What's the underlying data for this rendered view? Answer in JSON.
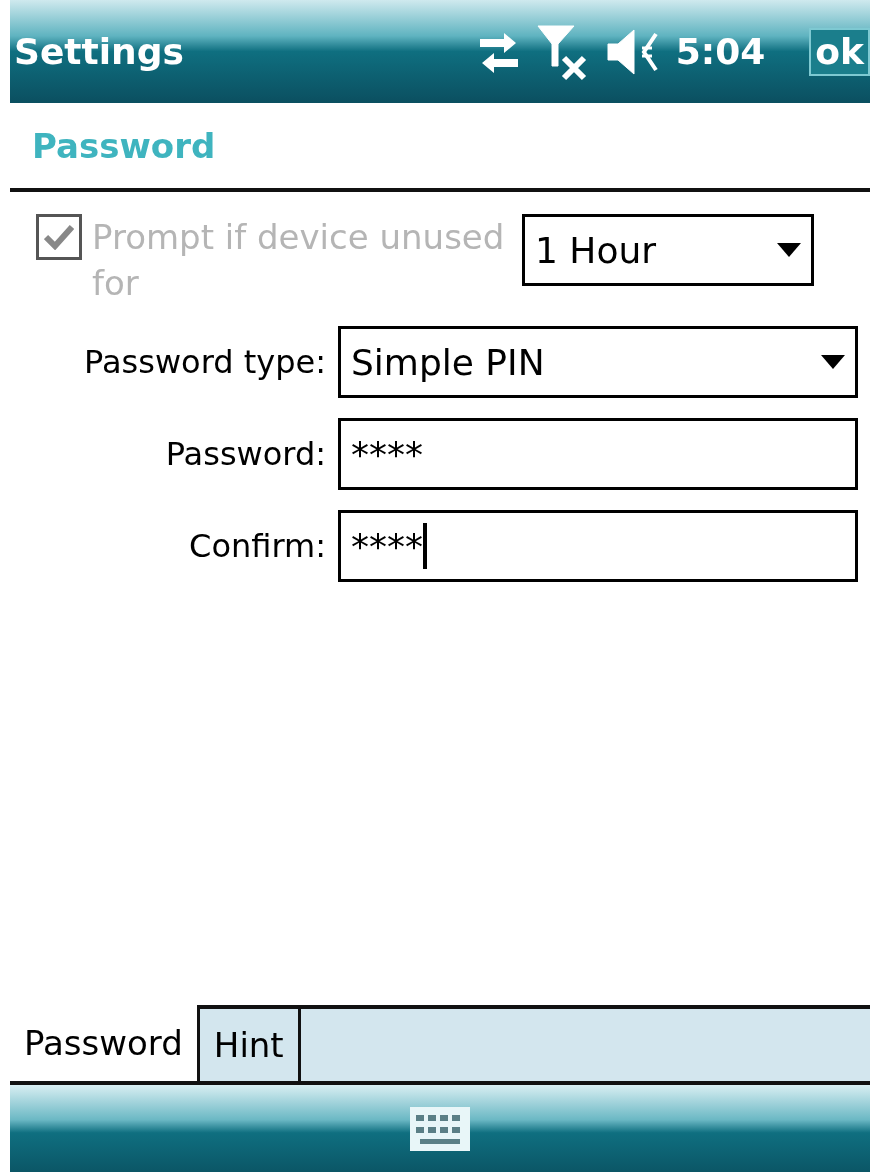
{
  "title_bar": {
    "title": "Settings",
    "time": "5:04",
    "ok": "ok"
  },
  "header": "Password",
  "prompt": {
    "label": "Prompt if device unused for",
    "checked": true,
    "disabled": true,
    "value": "1 Hour"
  },
  "fields": [
    {
      "kind": "select",
      "label": "Password type:",
      "value": "Simple PIN"
    },
    {
      "kind": "text",
      "label": "Password:",
      "value": "****",
      "focused": false
    },
    {
      "kind": "text",
      "label": "Confirm:",
      "value": "****",
      "focused": true
    }
  ],
  "tabs": [
    {
      "label": "Password",
      "selected": true
    },
    {
      "label": "Hint",
      "selected": false
    }
  ]
}
